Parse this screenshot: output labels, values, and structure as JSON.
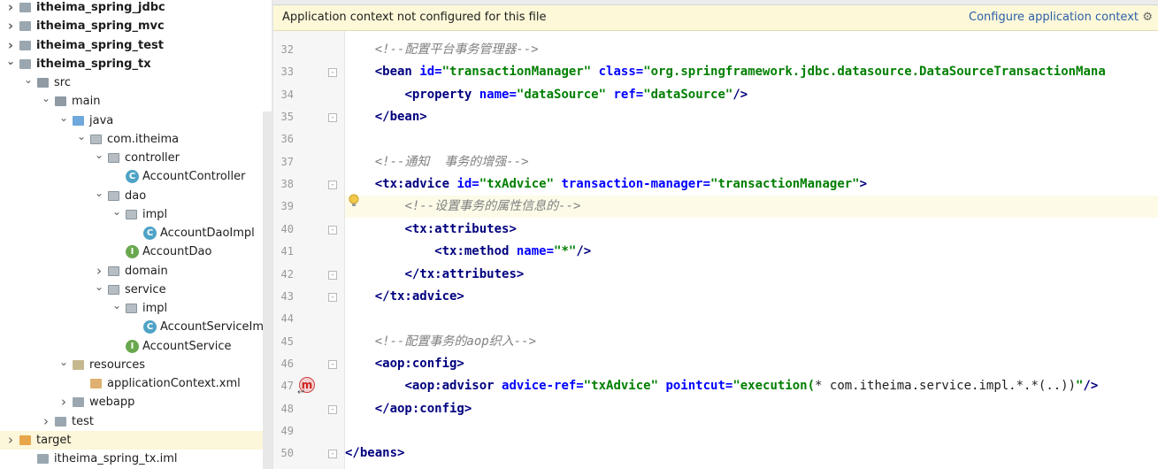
{
  "tree": [
    {
      "label": "itheima_spring_jdbc",
      "bold": true,
      "arrow": "›",
      "icon": "folder"
    },
    {
      "label": "itheima_spring_mvc",
      "bold": true,
      "arrow": "›",
      "icon": "folder"
    },
    {
      "label": "itheima_spring_test",
      "bold": true,
      "arrow": "›",
      "icon": "folder"
    },
    {
      "label": "itheima_spring_tx",
      "bold": true,
      "arrow": "⌄",
      "icon": "folder"
    },
    {
      "label": "src",
      "arrow": "⌄",
      "icon": "src"
    },
    {
      "label": "main",
      "arrow": "⌄",
      "icon": "src"
    },
    {
      "label": "java",
      "arrow": "⌄",
      "icon": "java"
    },
    {
      "label": "com.itheima",
      "arrow": "⌄",
      "icon": "pkg"
    },
    {
      "label": "controller",
      "arrow": "⌄",
      "icon": "pkg"
    },
    {
      "label": "AccountController",
      "arrow": "",
      "icon": "class"
    },
    {
      "label": "dao",
      "arrow": "⌄",
      "icon": "pkg"
    },
    {
      "label": "impl",
      "arrow": "⌄",
      "icon": "pkg"
    },
    {
      "label": "AccountDaoImpl",
      "arrow": "",
      "icon": "class"
    },
    {
      "label": "AccountDao",
      "arrow": "",
      "icon": "interface"
    },
    {
      "label": "domain",
      "arrow": "›",
      "icon": "pkg"
    },
    {
      "label": "service",
      "arrow": "⌄",
      "icon": "pkg"
    },
    {
      "label": "impl",
      "arrow": "⌄",
      "icon": "pkg"
    },
    {
      "label": "AccountServiceImpl",
      "arrow": "",
      "icon": "class"
    },
    {
      "label": "AccountService",
      "arrow": "",
      "icon": "interface"
    },
    {
      "label": "resources",
      "arrow": "⌄",
      "icon": "res"
    },
    {
      "label": "applicationContext.xml",
      "arrow": "",
      "icon": "xml"
    },
    {
      "label": "webapp",
      "arrow": "›",
      "icon": "folder"
    },
    {
      "label": "test",
      "arrow": "›",
      "icon": "folder"
    },
    {
      "label": "target",
      "arrow": "›",
      "icon": "target",
      "selected": true
    },
    {
      "label": "itheima_spring_tx.iml",
      "arrow": "",
      "icon": "iml"
    }
  ],
  "banner": {
    "message": "Application context not configured for this file",
    "link": "Configure application context",
    "gear_icon": "gear-icon"
  },
  "editor": {
    "lines": [
      {
        "n": "32",
        "segs": [
          [
            "pun",
            "    "
          ],
          [
            "cm",
            "<!--配置平台事务管理器-->"
          ]
        ]
      },
      {
        "n": "33",
        "fold": "-",
        "segs": [
          [
            "pun",
            "    "
          ],
          [
            "tag",
            "<bean "
          ],
          [
            "attr",
            "id="
          ],
          [
            "val",
            "\"transactionManager\" "
          ],
          [
            "attr",
            "class="
          ],
          [
            "val",
            "\"org.springframework.jdbc.datasource.DataSourceTransactionMana"
          ]
        ]
      },
      {
        "n": "34",
        "segs": [
          [
            "pun",
            "        "
          ],
          [
            "tag",
            "<property "
          ],
          [
            "attr",
            "name="
          ],
          [
            "val",
            "\"dataSource\" "
          ],
          [
            "attr",
            "ref="
          ],
          [
            "val",
            "\"dataSource\""
          ],
          [
            "tag",
            "/>"
          ]
        ]
      },
      {
        "n": "35",
        "fold": "-",
        "segs": [
          [
            "pun",
            "    "
          ],
          [
            "tag",
            "</bean>"
          ]
        ]
      },
      {
        "n": "36",
        "segs": []
      },
      {
        "n": "37",
        "segs": [
          [
            "pun",
            "    "
          ],
          [
            "cm",
            "<!--通知  事务的增强-->"
          ]
        ]
      },
      {
        "n": "38",
        "fold": "-",
        "segs": [
          [
            "pun",
            "    "
          ],
          [
            "tag",
            "<tx:advice "
          ],
          [
            "attr",
            "id="
          ],
          [
            "val",
            "\"txAdvice\" "
          ],
          [
            "attr",
            "transaction-manager="
          ],
          [
            "val",
            "\"transactionManager\""
          ],
          [
            "tag",
            ">"
          ]
        ]
      },
      {
        "n": "39",
        "hl": true,
        "segs": [
          [
            "pun",
            "        "
          ],
          [
            "cm",
            "<!--设置事务的属性信息的-->"
          ]
        ]
      },
      {
        "n": "40",
        "fold": "-",
        "segs": [
          [
            "pun",
            "        "
          ],
          [
            "tag",
            "<tx:attributes>"
          ]
        ]
      },
      {
        "n": "41",
        "segs": [
          [
            "pun",
            "            "
          ],
          [
            "tag",
            "<tx:method "
          ],
          [
            "attr",
            "name="
          ],
          [
            "val",
            "\"*\""
          ],
          [
            "tag",
            "/>"
          ]
        ]
      },
      {
        "n": "42",
        "fold": "-",
        "segs": [
          [
            "pun",
            "        "
          ],
          [
            "tag",
            "</tx:attributes>"
          ]
        ]
      },
      {
        "n": "43",
        "fold": "-",
        "segs": [
          [
            "pun",
            "    "
          ],
          [
            "tag",
            "</tx:advice>"
          ]
        ]
      },
      {
        "n": "44",
        "segs": []
      },
      {
        "n": "45",
        "segs": [
          [
            "pun",
            "    "
          ],
          [
            "cm",
            "<!--配置事务的aop织入-->"
          ]
        ]
      },
      {
        "n": "46",
        "fold": "-",
        "segs": [
          [
            "pun",
            "    "
          ],
          [
            "tag",
            "<aop:config>"
          ]
        ]
      },
      {
        "n": "47",
        "segs": [
          [
            "pun",
            "        "
          ],
          [
            "tag",
            "<aop:advisor "
          ],
          [
            "attr",
            "advice-ref="
          ],
          [
            "val",
            "\"txAdvice\" "
          ],
          [
            "attr",
            "pointcut="
          ],
          [
            "val",
            "\"execution("
          ],
          [
            "pun",
            "* com.itheima.service.impl.*.*(..))"
          ],
          [
            "val",
            "\""
          ],
          [
            "tag",
            "/>"
          ]
        ]
      },
      {
        "n": "48",
        "fold": "-",
        "segs": [
          [
            "pun",
            "    "
          ],
          [
            "tag",
            "</aop:config>"
          ]
        ]
      },
      {
        "n": "49",
        "segs": []
      },
      {
        "n": "50",
        "fold": "-",
        "segs": [
          [
            "tag",
            "</beans>"
          ]
        ]
      }
    ],
    "bulb_icon": "lightbulb-icon",
    "gutter_icon": "aop-method-icon",
    "gutter_icon_letter": "m"
  }
}
